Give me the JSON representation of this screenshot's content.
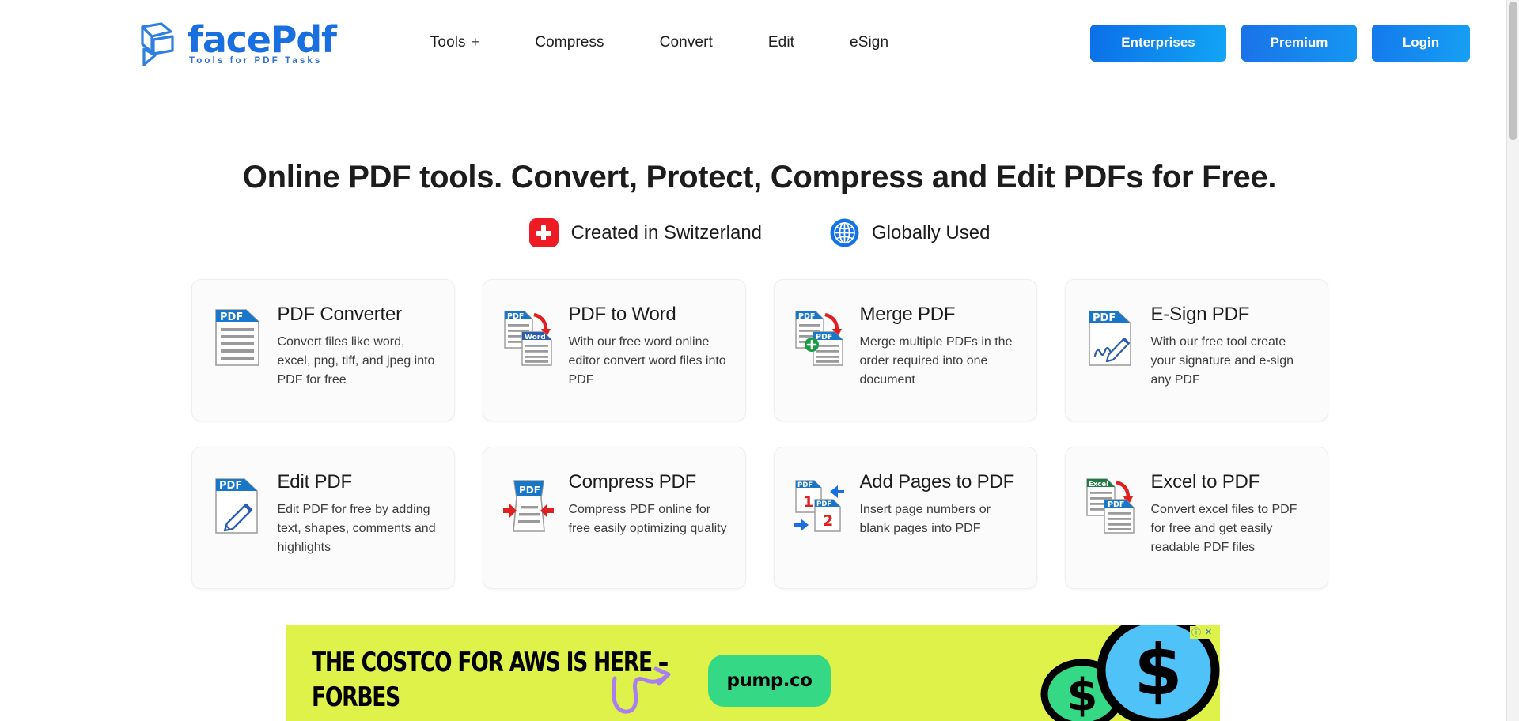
{
  "header": {
    "logo": {
      "word_part1": "face",
      "word_part2": "Pdf",
      "tagline": "Tools for PDF Tasks"
    },
    "nav": [
      {
        "label": "Tools",
        "has_plus": true,
        "plus": "+"
      },
      {
        "label": "Compress",
        "has_plus": false
      },
      {
        "label": "Convert",
        "has_plus": false
      },
      {
        "label": "Edit",
        "has_plus": false
      },
      {
        "label": "eSign",
        "has_plus": false
      }
    ],
    "actions": {
      "enterprises": "Enterprises",
      "premium": "Premium",
      "login": "Login"
    }
  },
  "hero": {
    "headline": "Online PDF tools. Convert, Protect, Compress and Edit PDFs for Free.",
    "badges": [
      {
        "icon": "swiss-cross-icon",
        "label": "Created in Switzerland"
      },
      {
        "icon": "globe-icon",
        "label": "Globally Used"
      }
    ]
  },
  "tools": [
    {
      "icon": "pdf-document-icon",
      "title": "PDF Converter",
      "desc": "Convert files like word, excel, png, tiff, and jpeg into PDF for free"
    },
    {
      "icon": "pdf-to-word-icon",
      "title": "PDF to Word",
      "desc": "With our free word online editor convert word files into PDF"
    },
    {
      "icon": "merge-pdf-icon",
      "title": "Merge PDF",
      "desc": "Merge multiple PDFs in the order required into one document"
    },
    {
      "icon": "esign-pdf-icon",
      "title": "E-Sign PDF",
      "desc": "With our free tool create your signature and e-sign any PDF"
    },
    {
      "icon": "edit-pdf-icon",
      "title": "Edit PDF",
      "desc": "Edit PDF for free by adding text, shapes, comments and highlights"
    },
    {
      "icon": "compress-pdf-icon",
      "title": "Compress PDF",
      "desc": "Compress PDF online for free easily optimizing quality"
    },
    {
      "icon": "add-pages-icon",
      "title": "Add Pages to PDF",
      "desc": "Insert page numbers or blank pages into PDF"
    },
    {
      "icon": "excel-to-pdf-icon",
      "title": "Excel to PDF",
      "desc": "Convert excel files to PDF for free and get easily readable PDF files"
    }
  ],
  "ad": {
    "headline_line1": "THE COSTCO FOR AWS IS HERE –",
    "headline_line2": "FORBES",
    "brand": "pump.co",
    "info_label": "ⓘ",
    "close_label": "✕",
    "background_color": "#dff249"
  },
  "labels": {
    "pdf": "PDF",
    "word": "Word",
    "excel": "Excel",
    "num_one": "1",
    "num_two": "2",
    "dollar": "$"
  }
}
